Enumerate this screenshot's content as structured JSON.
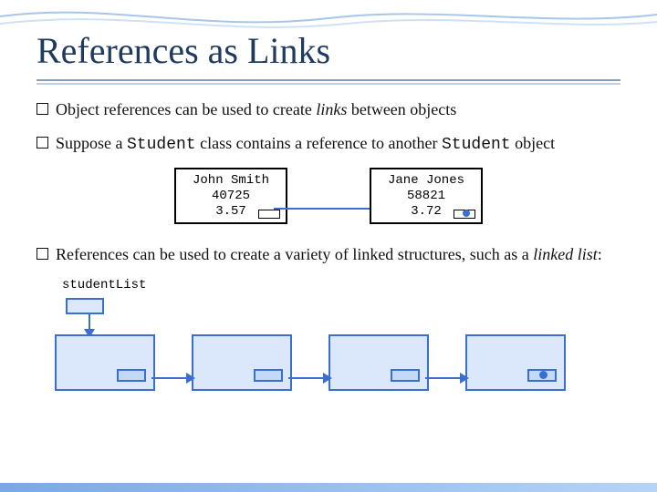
{
  "title": "References as Links",
  "bullets": {
    "b1_pre": "Object references can be used to create ",
    "b1_em": "links",
    "b1_post": " between objects",
    "b2_pre": "Suppose a ",
    "b2_code1": "Student",
    "b2_mid": " class contains a reference to another ",
    "b2_code2": "Student",
    "b2_post": " object",
    "b3_pre": "References can be used to create a variety of linked structures, such as a ",
    "b3_em": "linked list",
    "b3_post": ":"
  },
  "students": {
    "a": {
      "name": "John Smith",
      "id": "40725",
      "gpa": "3.57"
    },
    "b": {
      "name": "Jane Jones",
      "id": "58821",
      "gpa": "3.72"
    }
  },
  "list_label": "studentList",
  "colors": {
    "accent": "#3a6fcf",
    "fill": "#dbe8fb"
  }
}
